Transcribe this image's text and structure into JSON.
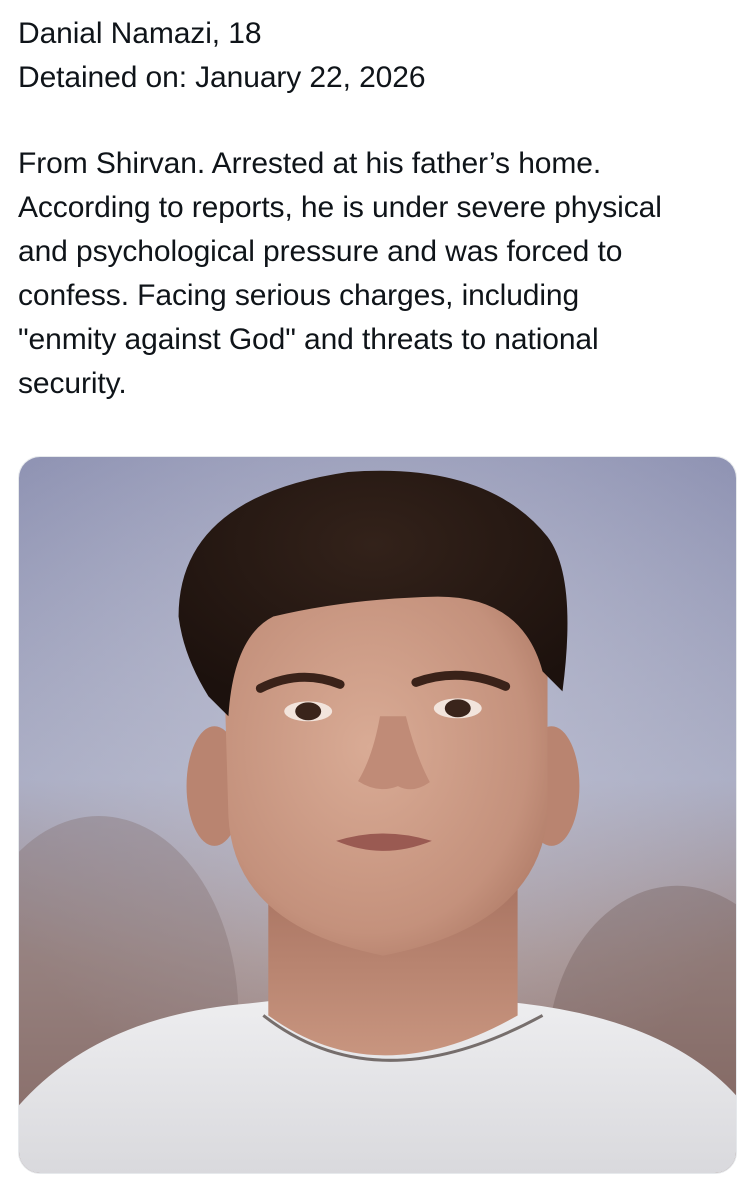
{
  "post": {
    "header_lines": [
      "Danial Namazi, 18",
      "Detained on: January 22, 2026"
    ],
    "body_lines": [
      "From Shirvan. Arrested at his father’s home.",
      "According to reports, he is under severe physical",
      "and psychological pressure and was forced to",
      "confess. Facing serious charges, including",
      "\"enmity against God\" and threats to national",
      "security."
    ]
  },
  "media": {
    "type": "photo",
    "subject": "portrait",
    "colors": {
      "background_top": "#8f93b3",
      "background_bottom": "#9a7a70",
      "hair": "#241712",
      "skin": "#c89a86",
      "shirt": "#e7e7e9"
    }
  }
}
